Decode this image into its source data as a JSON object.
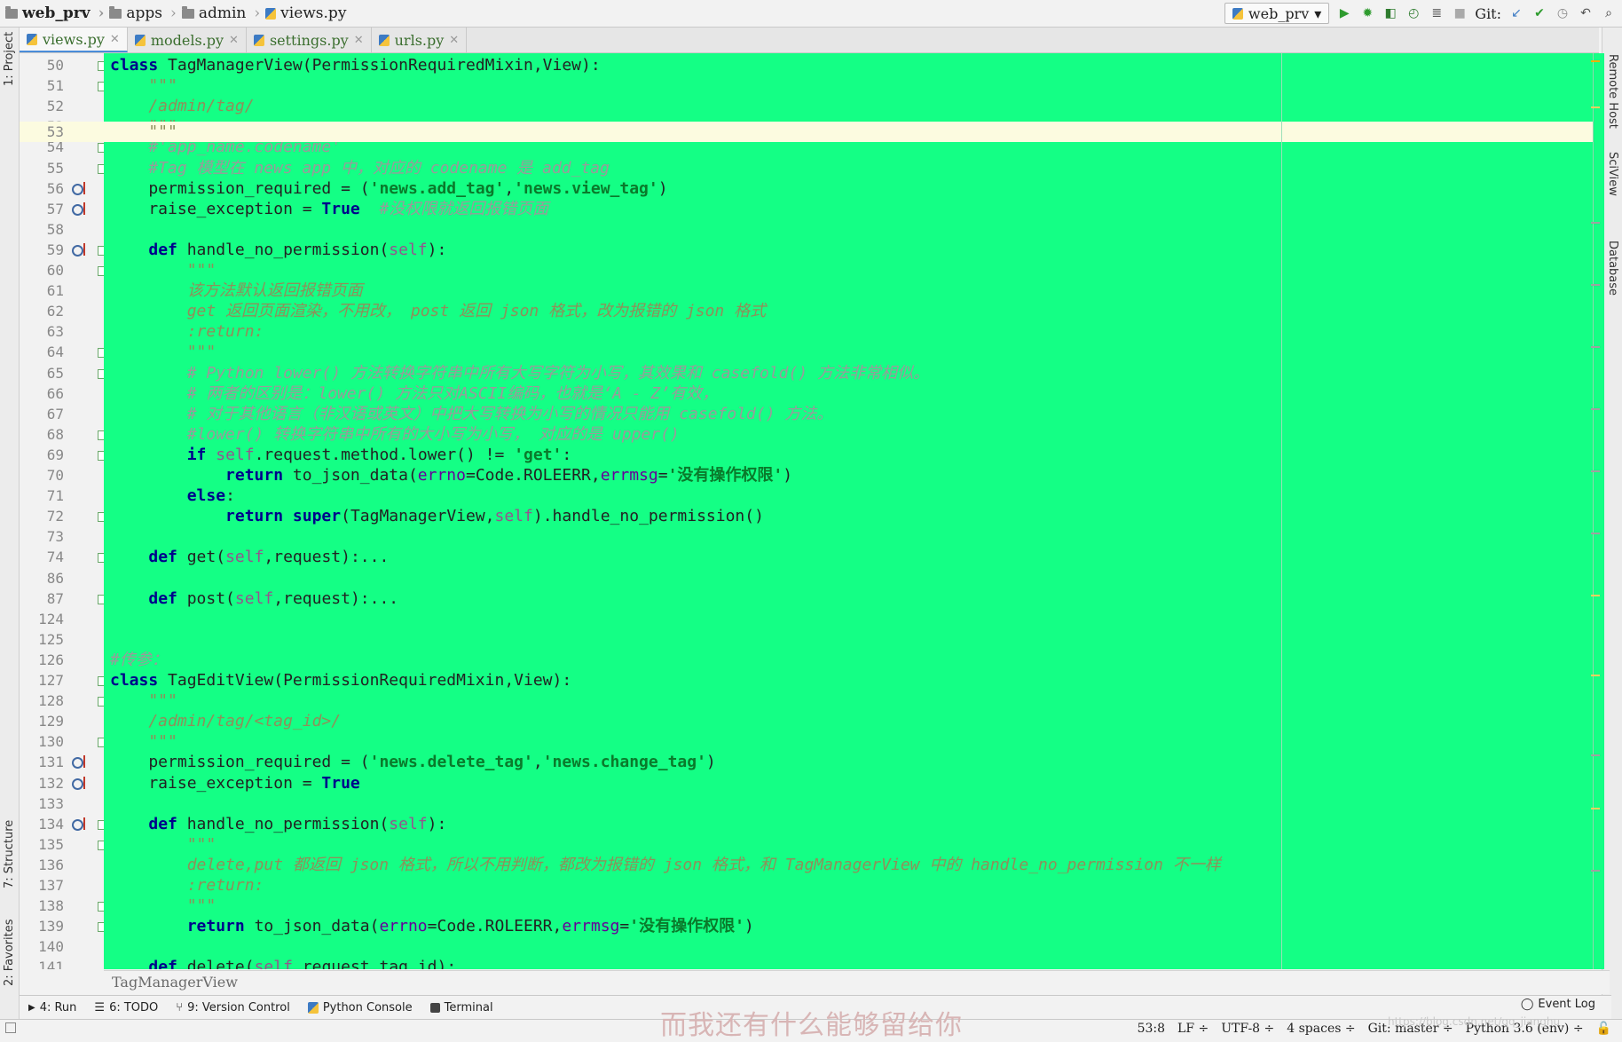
{
  "nav": {
    "breadcrumbs": [
      "web_prv",
      "apps",
      "admin",
      "views.py"
    ],
    "run_config": "web_prv",
    "git_label": "Git:"
  },
  "tabs": [
    {
      "label": "views.py",
      "active": true
    },
    {
      "label": "models.py",
      "active": false
    },
    {
      "label": "settings.py",
      "active": false
    },
    {
      "label": "urls.py",
      "active": false
    }
  ],
  "left_tools": [
    "1: Project",
    "7: Structure",
    "2: Favorites"
  ],
  "right_tools": [
    "Remote Host",
    "SciView",
    "Database"
  ],
  "editor": {
    "background": "#14ff85",
    "lines": [
      {
        "n": "50",
        "code": "class TagManagerView(PermissionRequiredMixin,View):"
      },
      {
        "n": "51",
        "code": "    \"\"\""
      },
      {
        "n": "52",
        "code": "    /admin/tag/"
      },
      {
        "n": "53",
        "code": "    \"\"\""
      },
      {
        "n": "54",
        "code": "    #'app_name.codename'"
      },
      {
        "n": "55",
        "code": "    #Tag 模型在 news app 中，对应的 codename 是 add_tag"
      },
      {
        "n": "56",
        "code": "    permission_required = ('news.add_tag','news.view_tag')"
      },
      {
        "n": "57",
        "code": "    raise_exception = True  #没权限就返回报错页面"
      },
      {
        "n": "58",
        "code": ""
      },
      {
        "n": "59",
        "code": "    def handle_no_permission(self):"
      },
      {
        "n": "60",
        "code": "        \"\"\""
      },
      {
        "n": "61",
        "code": "        该方法默认返回报错页面"
      },
      {
        "n": "62",
        "code": "        get 返回页面渲染，不用改， post 返回 json 格式，改为报错的 json 格式"
      },
      {
        "n": "63",
        "code": "        :return:"
      },
      {
        "n": "64",
        "code": "        \"\"\""
      },
      {
        "n": "65",
        "code": "        # Python lower() 方法转换字符串中所有大写字符为小写，其效果和 casefold() 方法非常相似。"
      },
      {
        "n": "66",
        "code": "        # 两者的区别是：lower() 方法只对ASCII编码，也就是‘A - Z’有效，"
      },
      {
        "n": "67",
        "code": "        # 对于其他语言（非汉语或英文）中把大写转换为小写的情况只能用 casefold() 方法。"
      },
      {
        "n": "68",
        "code": "        #lower() 转换字符串中所有的大小写为小写， 对应的是 upper()"
      },
      {
        "n": "69",
        "code": "        if self.request.method.lower() != 'get':"
      },
      {
        "n": "70",
        "code": "            return to_json_data(errno=Code.ROLEERR,errmsg='没有操作权限')"
      },
      {
        "n": "71",
        "code": "        else:"
      },
      {
        "n": "72",
        "code": "            return super(TagManagerView,self).handle_no_permission()"
      },
      {
        "n": "73",
        "code": ""
      },
      {
        "n": "74",
        "code": "    def get(self,request):..."
      },
      {
        "n": "86",
        "code": ""
      },
      {
        "n": "87",
        "code": "    def post(self,request):..."
      },
      {
        "n": "124",
        "code": ""
      },
      {
        "n": "125",
        "code": ""
      },
      {
        "n": "126",
        "code": "#传参："
      },
      {
        "n": "127",
        "code": "class TagEditView(PermissionRequiredMixin,View):"
      },
      {
        "n": "128",
        "code": "    \"\"\""
      },
      {
        "n": "129",
        "code": "    /admin/tag/<tag_id>/"
      },
      {
        "n": "130",
        "code": "    \"\"\""
      },
      {
        "n": "131",
        "code": "    permission_required = ('news.delete_tag','news.change_tag')"
      },
      {
        "n": "132",
        "code": "    raise_exception = True"
      },
      {
        "n": "133",
        "code": ""
      },
      {
        "n": "134",
        "code": "    def handle_no_permission(self):"
      },
      {
        "n": "135",
        "code": "        \"\"\""
      },
      {
        "n": "136",
        "code": "        delete,put 都返回 json 格式，所以不用判断，都改为报错的 json 格式，和 TagManagerView 中的 handle_no_permission 不一样"
      },
      {
        "n": "137",
        "code": "        :return:"
      },
      {
        "n": "138",
        "code": "        \"\"\""
      },
      {
        "n": "139",
        "code": "        return to_json_data(errno=Code.ROLEERR,errmsg='没有操作权限')"
      },
      {
        "n": "140",
        "code": ""
      },
      {
        "n": "141",
        "code": "    def delete(self,request,tag_id):..."
      }
    ]
  },
  "breadcrumb_footer": "TagManagerView",
  "tool_windows": [
    "4: Run",
    "6: TODO",
    "9: Version Control",
    "Python Console",
    "Terminal"
  ],
  "event_log": "Event Log",
  "status": {
    "position": "53:8",
    "line_sep": "LF ÷",
    "encoding": "UTF-8 ÷",
    "indent": "4 spaces ÷",
    "git": "Git: master ÷",
    "interpreter": "Python 3.6 (env) ÷"
  },
  "watermark": "而我还有什么能够留给你",
  "watermark_url": "https://blog.csdn.net/qq_jianghu"
}
